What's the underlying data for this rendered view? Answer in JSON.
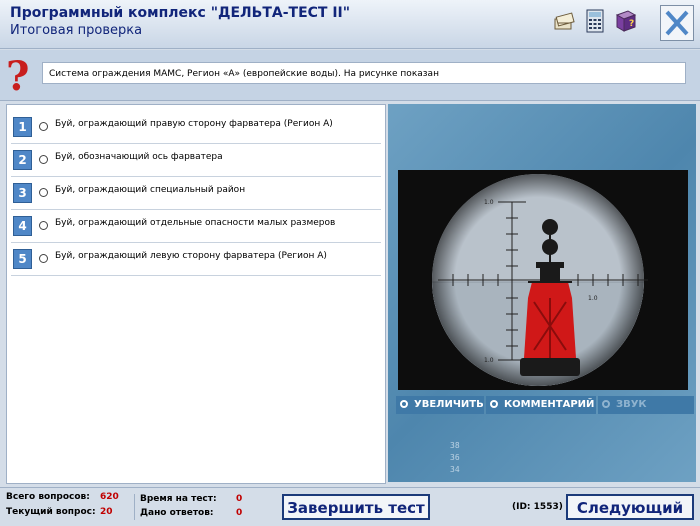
{
  "header": {
    "app_title": "Программный комплекс \"ДЕЛЬТА-ТЕСТ II\"",
    "subtitle": "Итоговая проверка",
    "icons": [
      "books-icon",
      "calculator-icon",
      "help-book-icon",
      "close-icon"
    ]
  },
  "question": {
    "text": "Система ограждения МАМС, Регион «А» (европейские воды). На рисунке показан"
  },
  "answers": [
    {
      "number": "1",
      "label": "Буй, ограждающий правую сторону фарватера (Регион А)"
    },
    {
      "number": "2",
      "label": "Буй, обозначающий ось фарватера"
    },
    {
      "number": "3",
      "label": "Буй, ограждающий специальный район"
    },
    {
      "number": "4",
      "label": "Буй, ограждающий отдельные опасности малых размеров"
    },
    {
      "number": "5",
      "label": "Буй, ограждающий левую сторону фарватера (Регион А)"
    }
  ],
  "image_panel": {
    "scale_top": "1.0",
    "scale_bottom": "1.0",
    "scale_right": "1.0",
    "corner_numbers": [
      "38",
      "36",
      "34"
    ],
    "buttons": {
      "zoom": "УВЕЛИЧИТЬ",
      "comment": "КОММЕНТАРИЙ",
      "sound": "ЗВУК"
    }
  },
  "status": {
    "total_label": "Всего вопросов:",
    "total_value": "620",
    "current_label": "Текущий вопрос:",
    "current_value": "20",
    "time_label": "Время на тест:",
    "time_value": "0",
    "answered_label": "Дано ответов:",
    "answered_value": "0",
    "finish_button": "Завершить тест",
    "id_text": "(ID: 1553)",
    "next_button": "Следующий"
  },
  "colors": {
    "title": "#11257a",
    "answer_number_bg": "#4f87c7",
    "counter_values": "#c00000",
    "buoy": "#d01818"
  }
}
